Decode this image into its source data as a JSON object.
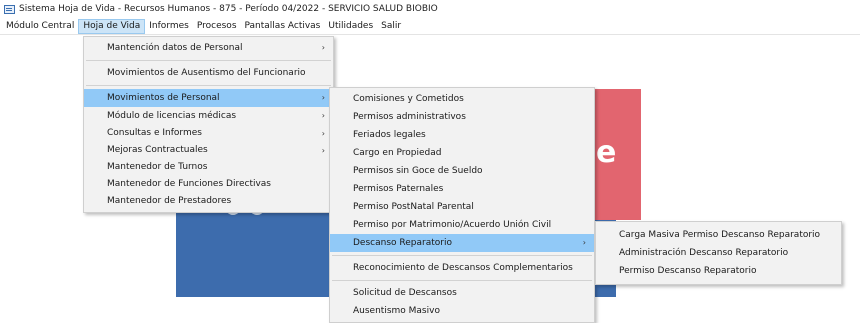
{
  "window": {
    "title": "Sistema Hoja de Vida - Recursos Humanos - 875 - Período 04/2022 - SERVICIO SALUD BIOBIO"
  },
  "menubar": {
    "items": [
      "Módulo Central",
      "Hoja de Vida",
      "Informes",
      "Procesos",
      "Pantallas Activas",
      "Utilidades",
      "Salir"
    ],
    "active": "Hoja de Vida"
  },
  "background": {
    "letter": "e",
    "colors": {
      "panel": "#3d6cad",
      "accent": "#e2656f"
    }
  },
  "menu_hoja_de_vida": {
    "items": [
      {
        "label": "Mantención datos de Personal",
        "submenu": true
      },
      {
        "label": "Movimientos de Ausentismo del Funcionario",
        "submenu": false
      },
      {
        "label": "Movimientos de Personal",
        "submenu": true,
        "selected": true
      },
      {
        "label": "Módulo de licencias médicas",
        "submenu": true
      },
      {
        "label": "Consultas e Informes",
        "submenu": true
      },
      {
        "label": "Mejoras Contractuales",
        "submenu": true
      },
      {
        "label": "Mantenedor de Turnos",
        "submenu": false
      },
      {
        "label": "Mantenedor de Funciones Directivas",
        "submenu": false
      },
      {
        "label": "Mantenedor de Prestadores",
        "submenu": false
      }
    ]
  },
  "menu_movimientos_personal": {
    "items": [
      {
        "label": "Comisiones y Cometidos"
      },
      {
        "label": "Permisos administrativos"
      },
      {
        "label": "Feriados legales"
      },
      {
        "label": "Cargo en Propiedad"
      },
      {
        "label": "Permisos sin Goce de Sueldo"
      },
      {
        "label": "Permisos Paternales"
      },
      {
        "label": "Permiso PostNatal Parental"
      },
      {
        "label": "Permiso por Matrimonio/Acuerdo Unión Civil"
      },
      {
        "label": "Descanso Reparatorio",
        "submenu": true,
        "selected": true
      },
      {
        "label": "Reconocimiento de Descansos Complementarios"
      },
      {
        "label": "Solicitud de Descansos"
      },
      {
        "label": "Ausentismo Masivo"
      }
    ]
  },
  "menu_descanso_reparatorio": {
    "items": [
      {
        "label": "Carga Masiva Permiso Descanso Reparatorio"
      },
      {
        "label": "Administración Descanso Reparatorio"
      },
      {
        "label": "Permiso Descanso Reparatorio"
      }
    ]
  }
}
